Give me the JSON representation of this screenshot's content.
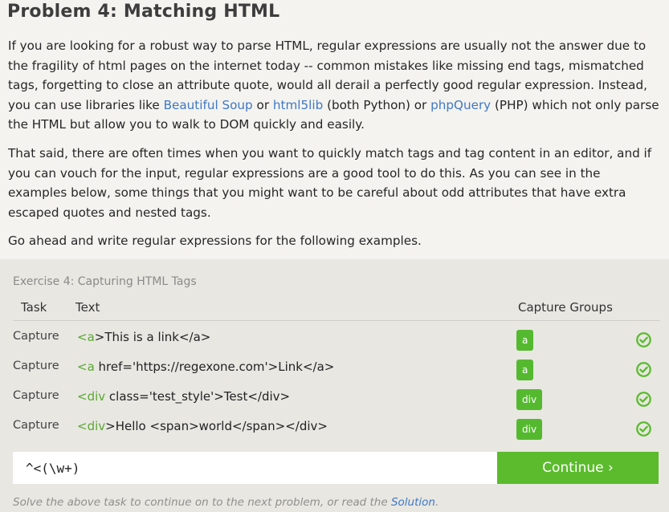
{
  "page": {
    "title": "Problem 4: Matching HTML"
  },
  "intro": {
    "p1_a": "If you are looking for a robust way to parse HTML, regular expressions are usually not the answer due to the fragility of html pages on the internet today -- common mistakes like missing end tags, mismatched tags, forgetting to close an attribute quote, would all derail a perfectly good regular expression. Instead, you can use libraries like ",
    "link_bs": "Beautiful Soup",
    "p1_b": " or ",
    "link_html5lib": "html5lib",
    "p1_c": " (both Python) or ",
    "link_phpquery": "phpQuery",
    "p1_d": " (PHP) which not only parse the HTML but allow you to walk to DOM quickly and easily.",
    "p2": "That said, there are often times when you want to quickly match tags and tag content in an editor, and if you can vouch for the input, regular expressions are a good tool to do this. As you can see in the examples below, some things that you might want to be careful about odd attributes that have extra escaped quotes and nested tags.",
    "p3": "Go ahead and write regular expressions for the following examples."
  },
  "exercise": {
    "title": "Exercise 4: Capturing HTML Tags",
    "headers": {
      "task": "Task",
      "text": "Text",
      "capture": "Capture Groups"
    },
    "rows": [
      {
        "task": "Capture",
        "tag_part": "<a",
        "rest": ">This is a link</a>",
        "group": "a",
        "status": "check-circle-icon"
      },
      {
        "task": "Capture",
        "tag_part": "<a",
        "rest": " href='https://regexone.com'>Link</a>",
        "group": "a",
        "status": "check-circle-icon"
      },
      {
        "task": "Capture",
        "tag_part": "<div",
        "rest": " class='test_style'>Test</div>",
        "group": "div",
        "status": "check-circle-icon"
      },
      {
        "task": "Capture",
        "tag_part": "<div",
        "rest": ">Hello <span>world</span></div>",
        "group": "div",
        "status": "check-circle-icon"
      }
    ],
    "input": {
      "value": "^<(\\w+)"
    },
    "continue_label": "Continue ›",
    "footer": {
      "text": "Solve the above task to continue on to the next problem, or read the ",
      "link": "Solution",
      "end": "."
    },
    "colors": {
      "accent_green": "#5bbb2d",
      "tag_green": "#5aa832",
      "link_blue": "#3f78c4"
    }
  }
}
